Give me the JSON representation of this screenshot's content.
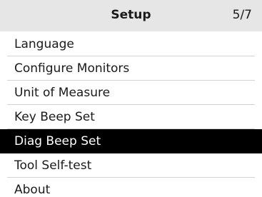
{
  "header": {
    "title": "Setup",
    "page_indicator": "5/7"
  },
  "menu": {
    "selected_index": 4,
    "items": [
      {
        "label": "Language"
      },
      {
        "label": "Configure Monitors"
      },
      {
        "label": "Unit of Measure"
      },
      {
        "label": "Key Beep Set"
      },
      {
        "label": "Diag Beep Set"
      },
      {
        "label": "Tool Self-test"
      },
      {
        "label": "About"
      }
    ]
  },
  "colors": {
    "header_bg": "#e6e6e6",
    "selected_bg": "#000000",
    "selected_text": "#ffffff",
    "separator": "#d4d4d4"
  }
}
